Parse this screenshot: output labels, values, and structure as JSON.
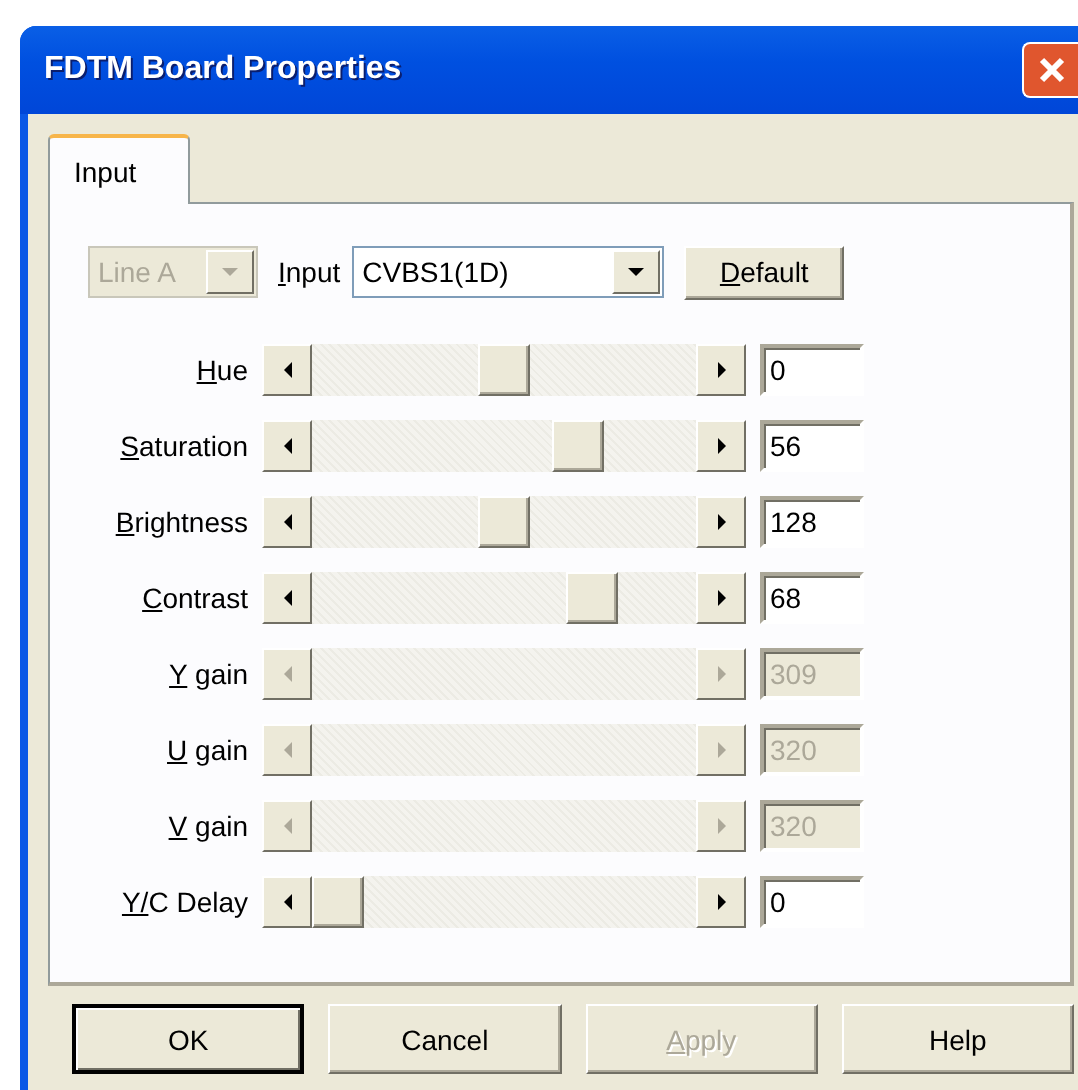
{
  "window": {
    "title": "FDTM Board Properties"
  },
  "tabs": [
    {
      "label": "Input",
      "selected": true
    }
  ],
  "source": {
    "line": {
      "value": "Line A",
      "disabled": true
    },
    "input_label": "Input",
    "input": {
      "value": "CVBS1(1D)",
      "disabled": false
    },
    "default_button": "Default"
  },
  "sliders": [
    {
      "label": "Hue",
      "disabled": false,
      "level": 0.5,
      "value": "0"
    },
    {
      "label": "Saturation",
      "disabled": false,
      "level": 0.72,
      "value": "56"
    },
    {
      "label": "Brightness",
      "disabled": false,
      "level": 0.5,
      "value": "128"
    },
    {
      "label": "Contrast",
      "disabled": false,
      "level": 0.765,
      "value": "68"
    },
    {
      "label": "Y gain",
      "disabled": true,
      "value": "309"
    },
    {
      "label": "U gain",
      "disabled": true,
      "value": "320"
    },
    {
      "label": "V gain",
      "disabled": true,
      "value": "320"
    },
    {
      "label": "Y/C Delay",
      "disabled": false,
      "level": 0,
      "value": "0"
    }
  ],
  "buttons": [
    {
      "label": "OK",
      "default": true,
      "disabled": false,
      "mnemonic": false
    },
    {
      "label": "Cancel",
      "default": false,
      "disabled": false,
      "mnemonic": false
    },
    {
      "label": "Apply",
      "default": false,
      "disabled": true,
      "mnemonic": true
    },
    {
      "label": "Help",
      "default": false,
      "disabled": false,
      "mnemonic": false
    }
  ]
}
